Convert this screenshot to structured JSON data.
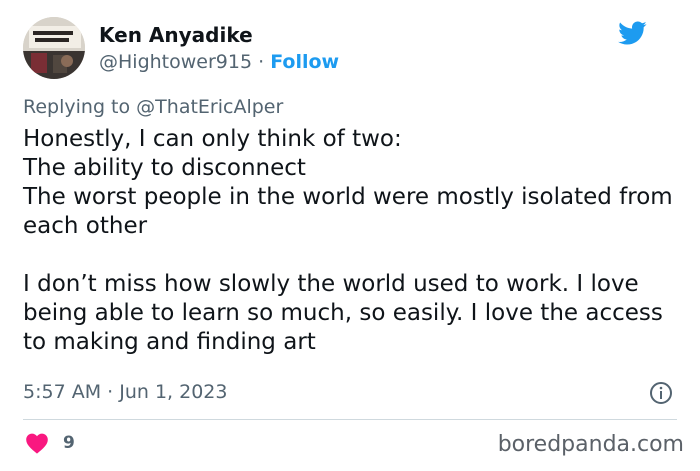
{
  "author": {
    "name": "Ken Anyadike",
    "handle": "@Hightower915",
    "separator": "·",
    "follow_label": "Follow"
  },
  "reply_context": {
    "prefix": "Replying to",
    "handle": "@ThatEricAlper"
  },
  "tweet": {
    "lines": [
      "Honestly, I can only think of two:",
      "The ability to disconnect",
      "The worst people in the world were mostly isolated from each other"
    ],
    "paragraph2": "I don’t miss how slowly the world used to work. I love being able to learn so much, so easily. I love the access to making and finding art",
    "timestamp": "5:57 AM · Jun 1, 2023"
  },
  "engagement": {
    "likes": "9"
  },
  "watermark": "boredpanda.com",
  "icons": {
    "brand": "twitter-bird-icon",
    "info": "info-icon",
    "like": "heart-icon"
  },
  "colors": {
    "accent": "#1d9bf0",
    "heart": "#f91880",
    "secondary_text": "#536471",
    "divider": "#cfd9de"
  }
}
